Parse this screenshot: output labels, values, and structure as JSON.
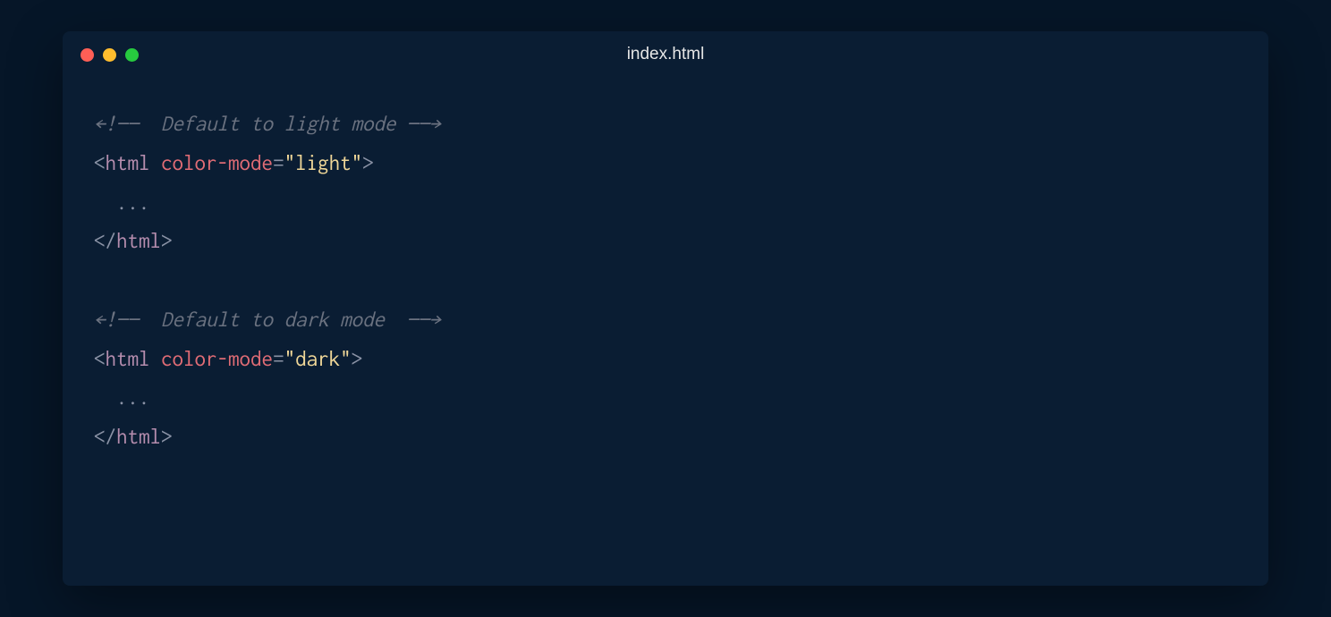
{
  "window": {
    "title": "index.html"
  },
  "code": {
    "line1_comment": "←!——  Default to light mode ——→",
    "line2": {
      "open": "<",
      "tag": "html",
      "space": " ",
      "attr": "color-mode",
      "eq": "=",
      "string": "\"light\"",
      "close": ">"
    },
    "line3_content": "  ...",
    "line4": {
      "open": "</",
      "tag": "html",
      "close": ">"
    },
    "line6_comment": "←!——  Default to dark mode  ——→",
    "line7": {
      "open": "<",
      "tag": "html",
      "space": " ",
      "attr": "color-mode",
      "eq": "=",
      "string": "\"dark\"",
      "close": ">"
    },
    "line8_content": "  ...",
    "line9": {
      "open": "</",
      "tag": "html",
      "close": ">"
    }
  }
}
